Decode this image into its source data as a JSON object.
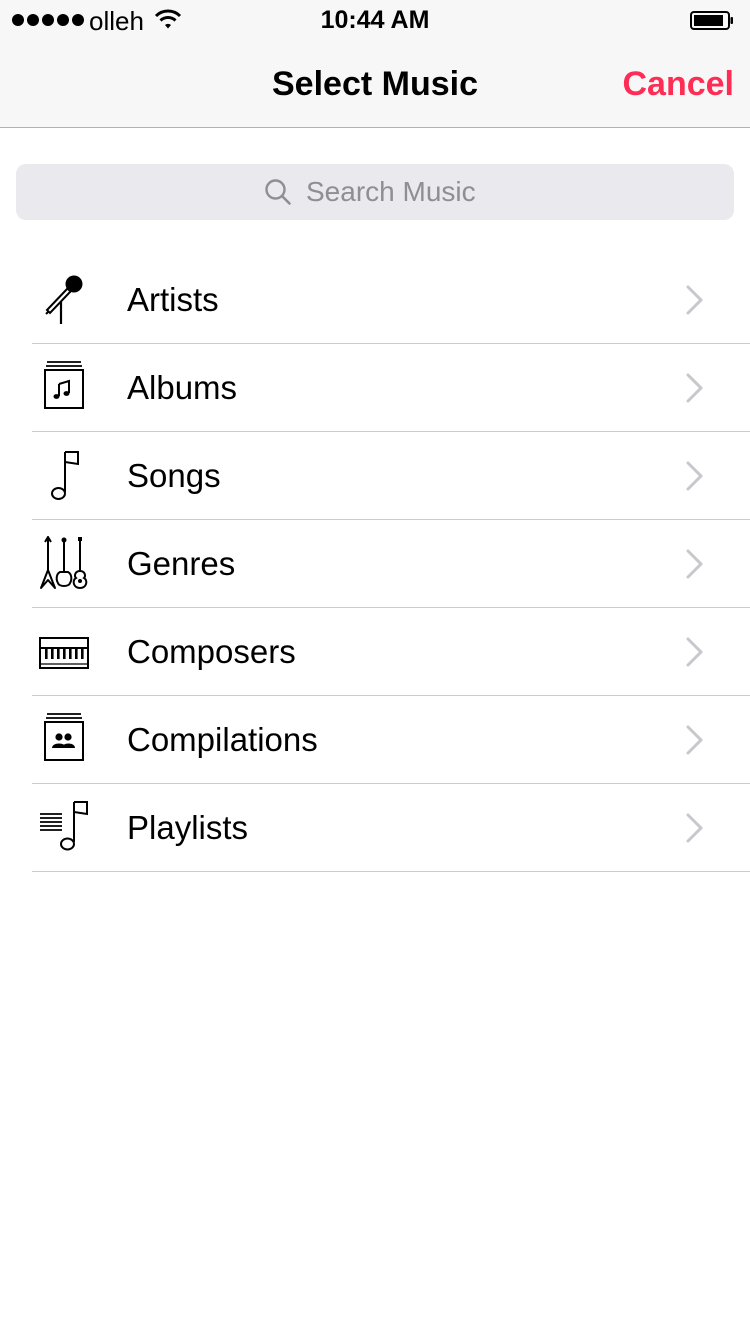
{
  "status_bar": {
    "carrier": "olleh",
    "time": "10:44 AM"
  },
  "nav": {
    "title": "Select Music",
    "cancel_label": "Cancel"
  },
  "search": {
    "placeholder": "Search Music",
    "value": ""
  },
  "colors": {
    "accent": "#ff2d55",
    "bar_background": "#f7f7f7",
    "search_background": "#e9e9ee",
    "separator": "#cbcbcf",
    "chevron": "#c7c7cc"
  },
  "categories": [
    {
      "label": "Artists",
      "icon": "microphone-icon"
    },
    {
      "label": "Albums",
      "icon": "album-icon"
    },
    {
      "label": "Songs",
      "icon": "music-note-icon"
    },
    {
      "label": "Genres",
      "icon": "guitars-icon"
    },
    {
      "label": "Composers",
      "icon": "piano-keyboard-icon"
    },
    {
      "label": "Compilations",
      "icon": "compilation-icon"
    },
    {
      "label": "Playlists",
      "icon": "playlist-icon"
    }
  ]
}
